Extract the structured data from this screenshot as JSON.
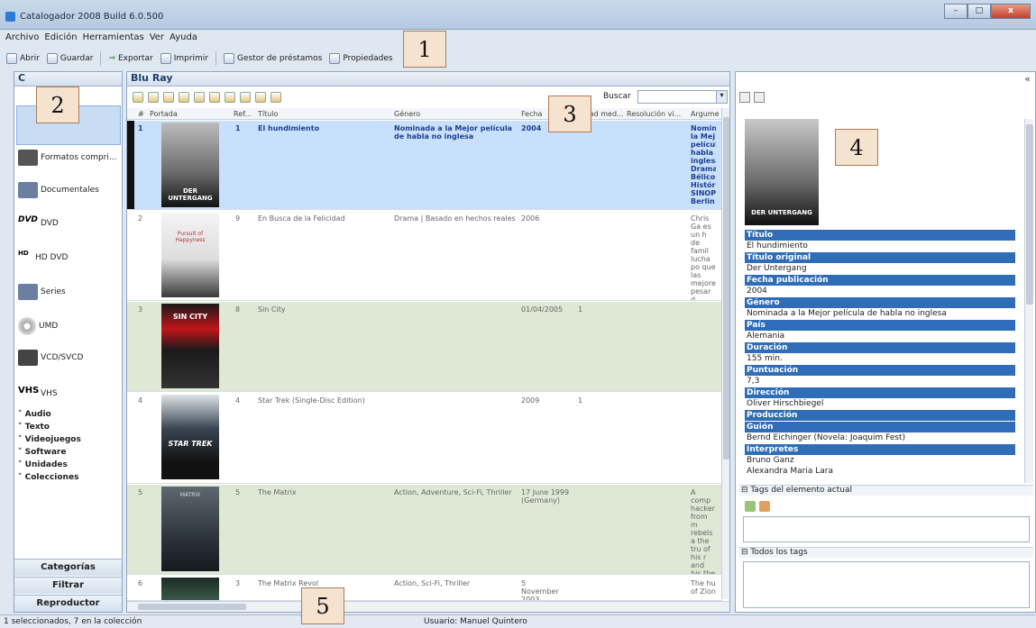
{
  "window": {
    "title": "Catalogador 2008 Build 6.0.500",
    "controls": [
      "–",
      "□",
      "x"
    ]
  },
  "menu": [
    "Archivo",
    "Edición",
    "Herramientas",
    "Ver",
    "Ayuda"
  ],
  "toolbar": {
    "abrir": "Abrir",
    "guardar": "Guardar",
    "exportar": "Exportar",
    "imprimir": "Imprimir",
    "gestor": "Gestor de préstamos",
    "propiedades": "Propiedades"
  },
  "left_pane": {
    "header": "C",
    "items": [
      {
        "label": "Formatos compri...",
        "icon": "formats-icon"
      },
      {
        "label": "Documentales",
        "icon": "film-reel-icon"
      },
      {
        "label": "DVD",
        "icon": "dvd-logo-icon"
      },
      {
        "label": "HD DVD",
        "icon": "hddvd-logo-icon"
      },
      {
        "label": "Series",
        "icon": "film-reel-icon"
      },
      {
        "label": "UMD",
        "icon": "disc-icon"
      },
      {
        "label": "VCD/SVCD",
        "icon": "vcd-logo-icon"
      },
      {
        "label": "VHS",
        "icon": "vhs-logo-icon"
      }
    ],
    "sections": [
      "Audio",
      "Texto",
      "Videojuegos",
      "Software",
      "Unidades",
      "Colecciones"
    ],
    "bottom_tabs": [
      "Categorías",
      "Filtrar",
      "Reproductor"
    ]
  },
  "center": {
    "title": "Blu Ray",
    "search_label": "Buscar",
    "search_value": "",
    "columns": [
      "#",
      "Portada",
      "Ref...",
      "Título",
      "Género",
      "Fecha",
      "...dad med...",
      "Resolución vi...",
      "Argume"
    ],
    "rows": [
      {
        "n": "1",
        "ref": "1",
        "title": "El hundimiento",
        "genre": "Nominada a la Mejor película de habla no inglesa",
        "date": "2004",
        "quality": "",
        "arg": "Nomin la Mej películ habla inglesa Drama Bélico. Histór SINOP Berlin",
        "poster_text": "DER UNTERGANG",
        "selected": true
      },
      {
        "n": "2",
        "ref": "9",
        "title": "En Busca de la Felicidad",
        "genre": "Drama | Basado en hechos reales",
        "date": "2006",
        "quality": "",
        "arg": "Chris Ga es un h de famil lucha po que las mejore pesar d valiente intentos ayudar",
        "poster_text": "Pursuit of Happyness",
        "selected": false
      },
      {
        "n": "3",
        "ref": "8",
        "title": "Sin City",
        "genre": "",
        "date": "01/04/2005",
        "quality": "1",
        "arg": "",
        "poster_text": "SIN CITY",
        "selected": false
      },
      {
        "n": "4",
        "ref": "4",
        "title": "Star Trek (Single-Disc Edition)",
        "genre": "",
        "date": "2009",
        "quality": "1",
        "arg": "",
        "poster_text": "STAR TREK",
        "selected": false
      },
      {
        "n": "5",
        "ref": "5",
        "title": "The Matrix",
        "genre": "Action, Adventure, Sci-Fi, Thriller",
        "date": "17 June 1999 (Germany)",
        "quality": "",
        "arg": "A comp hacker from m rebels a the tru of his r and his the wa the con of it",
        "poster_text": "MATRIX",
        "selected": false
      },
      {
        "n": "6",
        "ref": "3",
        "title": "The Matrix Revol",
        "genre": "Action, Sci-Fi, Thriller",
        "date": "5 November 2003 (Germany)",
        "quality": "",
        "arg": "The hu of Zion",
        "poster_text": "",
        "selected": false
      }
    ]
  },
  "detail": {
    "poster_text": "DER UNTERGANG",
    "fields": [
      {
        "label": "Título",
        "value": "El hundimiento"
      },
      {
        "label": "Título original",
        "value": "Der Untergang"
      },
      {
        "label": "Fecha publicación",
        "value": "2004"
      },
      {
        "label": "Género",
        "value": "Nominada a la Mejor película de habla no inglesa"
      },
      {
        "label": "País",
        "value": "Alemania"
      },
      {
        "label": "Duración",
        "value": "155 min."
      },
      {
        "label": "Puntuación",
        "value": "7,3"
      },
      {
        "label": "Dirección",
        "value": "Oliver Hirschbiegel"
      },
      {
        "label": "Producción",
        "value": ""
      },
      {
        "label": "Guión",
        "value": "Bernd Eichinger (Novela: Joaquim Fest)"
      },
      {
        "label": "Interpretes",
        "value": "Bruno Ganz"
      }
    ],
    "extra_value": "Alexandra Maria Lara",
    "tags_current": "Tags del elemento actual",
    "tags_all": "Todos los tags",
    "collapse": "«"
  },
  "status": {
    "selection": "1 seleccionados, 7 en la colección",
    "user": "Usuario: Manuel Quintero"
  },
  "callouts": [
    "1",
    "2",
    "3",
    "4",
    "5"
  ],
  "colors": {
    "accent": "#2f6db8",
    "selected_row": "#c8e0fb",
    "green_row": "#dfe8d4",
    "callout": "#f6e3cf"
  }
}
